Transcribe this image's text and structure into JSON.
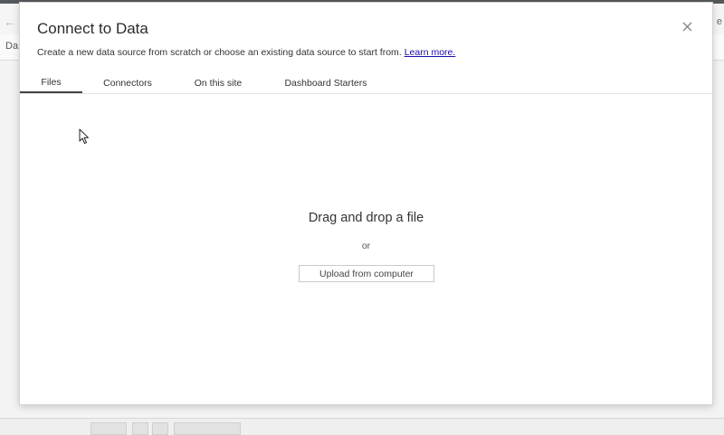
{
  "background_app": {
    "tab_fragment": "Da",
    "right_fragment": "e"
  },
  "dialog": {
    "title": "Connect to Data",
    "subtitle": "Create a new data source from scratch or choose an existing data source to start from.",
    "learn_more": "Learn more.",
    "tabs": [
      {
        "label": "Files",
        "active": true
      },
      {
        "label": "Connectors",
        "active": false
      },
      {
        "label": "On this site",
        "active": false
      },
      {
        "label": "Dashboard Starters",
        "active": false
      }
    ],
    "drop_zone": {
      "title": "Drag and drop a file",
      "or_text": "or",
      "upload_label": "Upload from computer"
    }
  },
  "icons": {
    "close": "close-icon",
    "cursor": "mouse-pointer-icon",
    "back": "back-arrow-icon"
  },
  "colors": {
    "link": "#1a0dab",
    "active_tab_underline": "#444444",
    "modal_bg": "#ffffff"
  }
}
